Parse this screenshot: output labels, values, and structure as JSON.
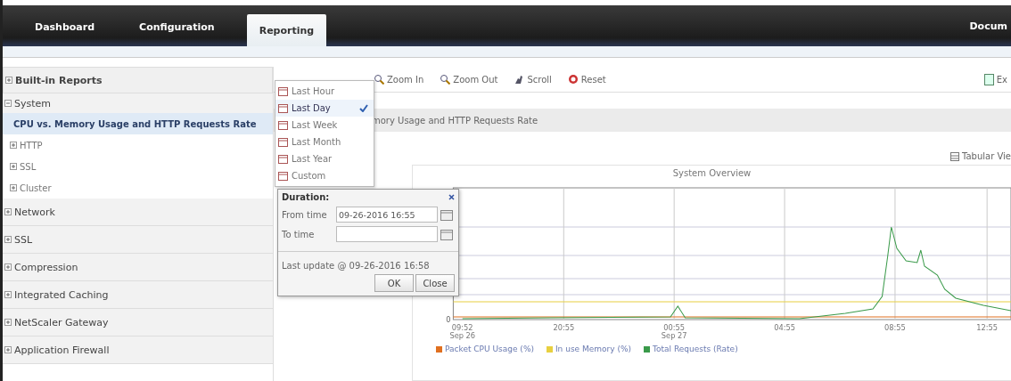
{
  "nav": {
    "tabs": [
      {
        "label": "Dashboard",
        "selected": false
      },
      {
        "label": "Configuration",
        "selected": false
      },
      {
        "label": "Reporting",
        "selected": true
      }
    ],
    "right_link": "Docum"
  },
  "sidebar": {
    "header": "Built-in Reports",
    "groups": [
      {
        "label": "System",
        "expanded": true,
        "children": [
          {
            "label": "CPU vs. Memory Usage and HTTP Requests Rate",
            "selected": true
          },
          {
            "label": "HTTP",
            "selected": false,
            "expanded": false
          },
          {
            "label": "SSL",
            "selected": false,
            "expanded": false
          },
          {
            "label": "Cluster",
            "selected": false,
            "expanded": false
          }
        ]
      },
      {
        "label": "Network",
        "expanded": false
      },
      {
        "label": "SSL",
        "expanded": false
      },
      {
        "label": "Compression",
        "expanded": false
      },
      {
        "label": "Integrated Caching",
        "expanded": false
      },
      {
        "label": "NetScaler Gateway",
        "expanded": false
      },
      {
        "label": "Application Firewall",
        "expanded": false
      }
    ]
  },
  "toolbar": {
    "buttons": [
      {
        "label": "Zoom In",
        "kind": "zoomin"
      },
      {
        "label": "Zoom Out",
        "kind": "zoomout"
      },
      {
        "label": "Scroll",
        "kind": "scroll"
      },
      {
        "label": "Reset",
        "kind": "reset"
      }
    ],
    "right_label": "Ex"
  },
  "report": {
    "title": "mory Usage and HTTP Requests Rate",
    "tabular_link": "Tabular Vie"
  },
  "chart": {
    "title": "System Overview",
    "y_label": "0",
    "x_labels": [
      {
        "time": "09:52",
        "date": "Sep 26"
      },
      {
        "time": "20:55"
      },
      {
        "time": "00:55",
        "date": "Sep 27"
      },
      {
        "time": "04:55"
      },
      {
        "time": "08:55"
      },
      {
        "time": "12:55"
      }
    ],
    "legend": [
      {
        "label": "Packet CPU Usage (%)",
        "color": "#e07020"
      },
      {
        "label": "In use Memory (%)",
        "color": "#e8d040"
      },
      {
        "label": "Total Requests (Rate)",
        "color": "#3a9a4a"
      }
    ]
  },
  "duration_menu": {
    "items": [
      {
        "label": "Last Hour",
        "selected": false
      },
      {
        "label": "Last Day",
        "selected": true
      },
      {
        "label": "Last Week",
        "selected": false
      },
      {
        "label": "Last Month",
        "selected": false
      },
      {
        "label": "Last Year",
        "selected": false
      },
      {
        "label": "Custom",
        "selected": false
      }
    ]
  },
  "duration_dialog": {
    "title": "Duration:",
    "from_label": "From time",
    "from_value": "09-26-2016 16:55",
    "to_label": "To time",
    "last_update": "Last update @ 09-26-2016 16:58",
    "buttons": [
      "OK",
      "Close"
    ]
  }
}
